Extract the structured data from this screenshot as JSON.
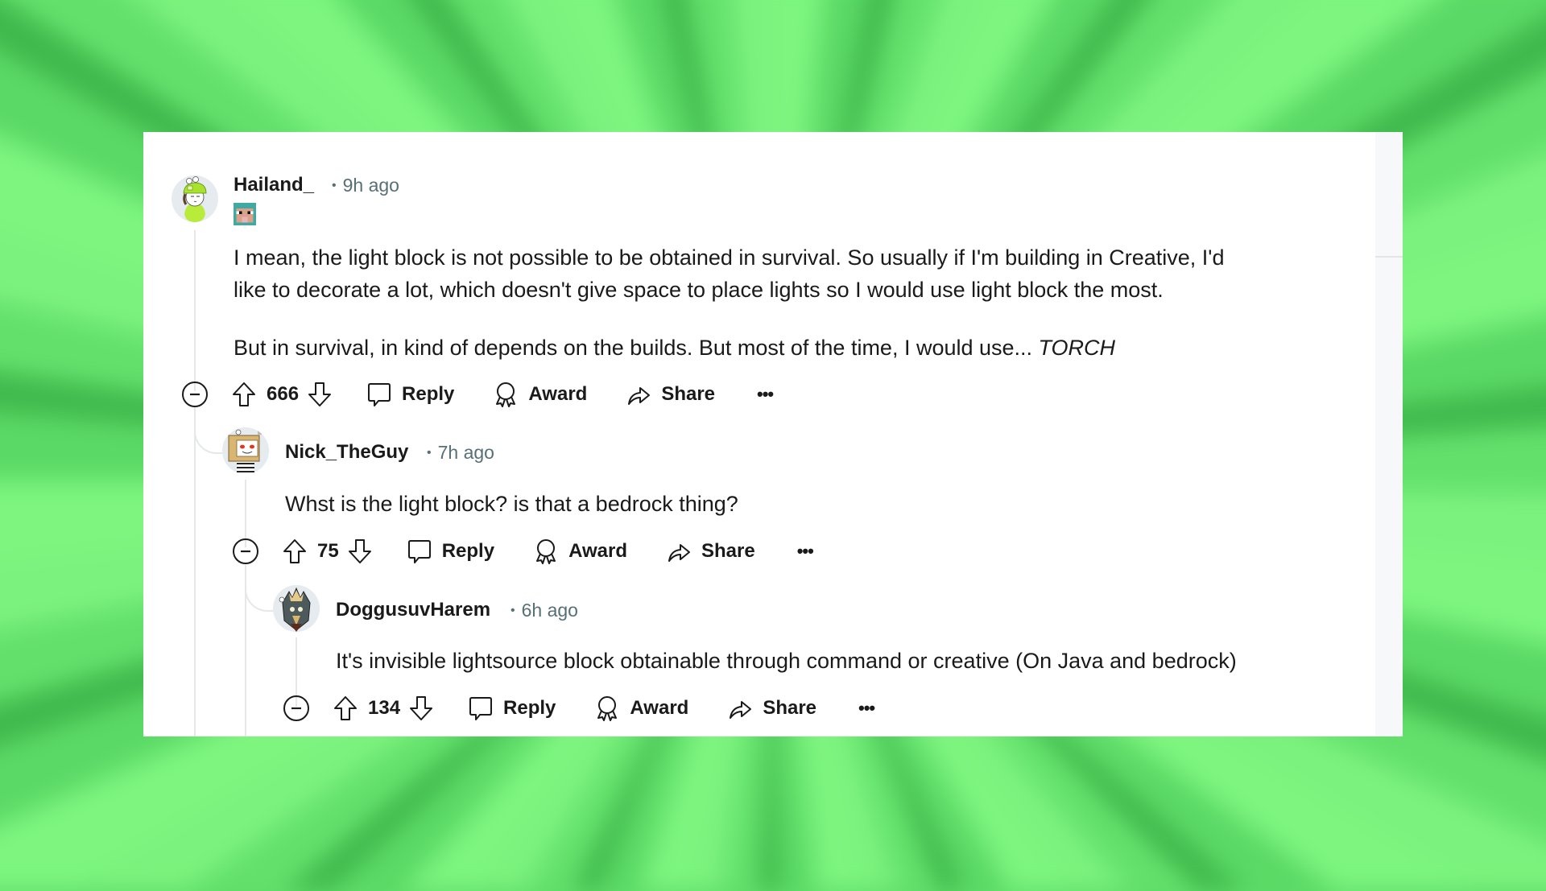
{
  "theme": {
    "card_bg": "#ffffff",
    "text": "#1a1a1b",
    "meta_text": "#576f76",
    "thread_line": "#e5e7e9",
    "background_green_light": "#7df57f",
    "background_green_dark": "#3fb94c"
  },
  "comments": [
    {
      "username": "Hailand_",
      "separator": "•",
      "time": "9h ago",
      "flair_icon": "minecraft-sheep-icon",
      "avatar_icon": "green-beanie-avatar",
      "body": [
        "I mean, the light block is not possible to be obtained in survival. So usually if I'm building in Creative, I'd",
        "like to decorate a lot, which doesn't give space to place lights so I would use light block the most."
      ],
      "body2_prefix": "But in survival, in kind of depends on the builds. But most of the time, I would use... ",
      "body2_emphasis": "TORCH",
      "votes": "666",
      "actions": {
        "reply": "Reply",
        "award": "Award",
        "share": "Share",
        "more": "•••"
      }
    },
    {
      "username": "Nick_TheGuy",
      "separator": "•",
      "time": "7h ago",
      "avatar_icon": "box-head-avatar",
      "body": [
        "Whst is the light block? is that a bedrock thing?"
      ],
      "votes": "75",
      "actions": {
        "reply": "Reply",
        "award": "Award",
        "share": "Share",
        "more": "•••"
      }
    },
    {
      "username": "DoggusuvHarem",
      "separator": "•",
      "time": "6h ago",
      "avatar_icon": "armored-knight-avatar",
      "body": [
        "It's invisible lightsource block obtainable through command or creative (On Java and bedrock)"
      ],
      "votes": "134",
      "actions": {
        "reply": "Reply",
        "award": "Award",
        "share": "Share",
        "more": "•••"
      }
    }
  ]
}
